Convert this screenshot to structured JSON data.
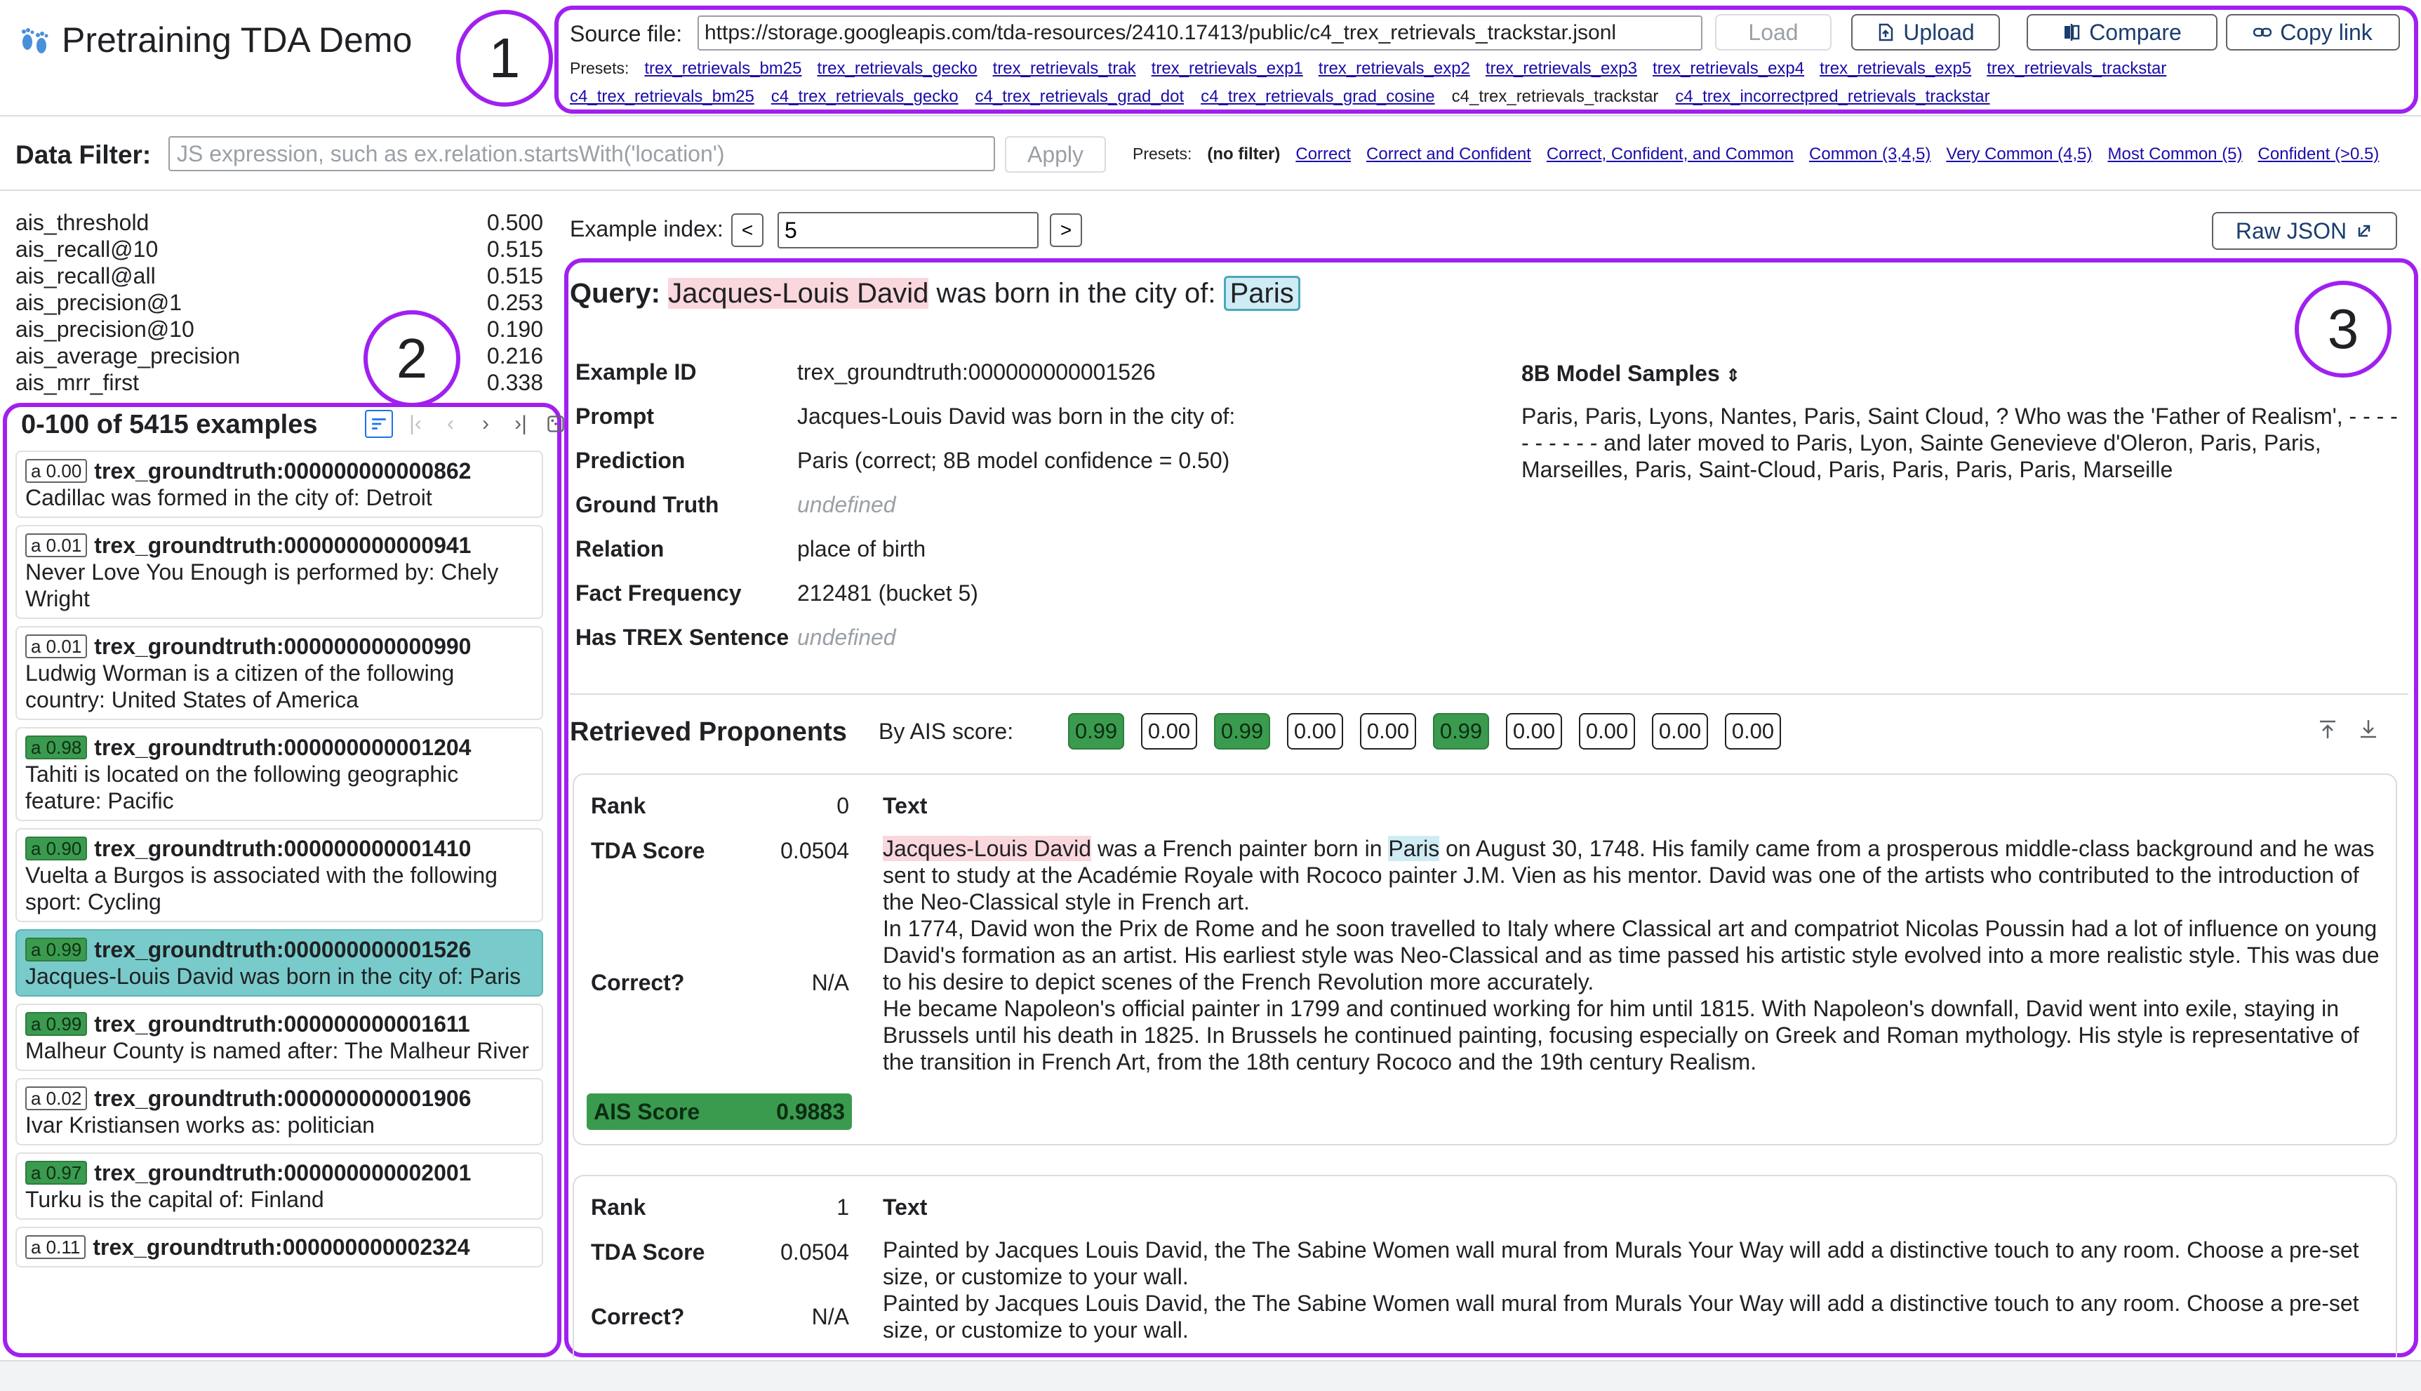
{
  "header": {
    "title": "Pretraining TDA Demo",
    "source_label": "Source file:",
    "source_value": "https://storage.googleapis.com/tda-resources/2410.17413/public/c4_trex_retrievals_trackstar.jsonl",
    "load": "Load",
    "upload": "Upload",
    "compare": "Compare",
    "copy_link": "Copy link",
    "presets_label": "Presets:",
    "presets_line1": [
      "trex_retrievals_bm25",
      "trex_retrievals_gecko",
      "trex_retrievals_trak",
      "trex_retrievals_exp1",
      "trex_retrievals_exp2",
      "trex_retrievals_exp3",
      "trex_retrievals_exp4",
      "trex_retrievals_exp5",
      "trex_retrievals_trackstar"
    ],
    "presets_line2": [
      "c4_trex_retrievals_bm25",
      "c4_trex_retrievals_gecko",
      "c4_trex_retrievals_grad_dot",
      "c4_trex_retrievals_grad_cosine",
      "c4_trex_retrievals_trackstar",
      "c4_trex_incorrectpred_retrievals_trackstar"
    ]
  },
  "annotations": {
    "one": "1",
    "two": "2",
    "three": "3"
  },
  "filter": {
    "label": "Data Filter:",
    "placeholder": "JS expression, such as ex.relation.startsWith('location')",
    "apply": "Apply",
    "presets_label": "Presets:",
    "no_filter": "(no filter)",
    "presets": [
      "Correct",
      "Correct and Confident",
      "Correct, Confident, and Common",
      "Common (3,4,5)",
      "Very Common (4,5)",
      "Most Common (5)",
      "Confident (>0.5)"
    ]
  },
  "metrics": [
    {
      "name": "ais_threshold",
      "value": "0.500"
    },
    {
      "name": "ais_recall@10",
      "value": "0.515"
    },
    {
      "name": "ais_recall@all",
      "value": "0.515"
    },
    {
      "name": "ais_precision@1",
      "value": "0.253"
    },
    {
      "name": "ais_precision@10",
      "value": "0.190"
    },
    {
      "name": "ais_average_precision",
      "value": "0.216"
    },
    {
      "name": "ais_mrr_first",
      "value": "0.338"
    }
  ],
  "list": {
    "header": "0-100 of 5415 examples",
    "items": [
      {
        "badge": "a 0.00",
        "hi": false,
        "id": "trex_groundtruth:000000000000862",
        "text": "Cadillac was formed in the city of: Detroit"
      },
      {
        "badge": "a 0.01",
        "hi": false,
        "id": "trex_groundtruth:000000000000941",
        "text": "Never Love You Enough is performed by: Chely Wright"
      },
      {
        "badge": "a 0.01",
        "hi": false,
        "id": "trex_groundtruth:000000000000990",
        "text": "Ludwig Worman is a citizen of the following country: United States of America"
      },
      {
        "badge": "a 0.98",
        "hi": true,
        "id": "trex_groundtruth:000000000001204",
        "text": "Tahiti is located on the following geographic feature: Pacific"
      },
      {
        "badge": "a 0.90",
        "hi": true,
        "id": "trex_groundtruth:000000000001410",
        "text": "Vuelta a Burgos is associated with the following sport: Cycling"
      },
      {
        "badge": "a 0.99",
        "hi": true,
        "id": "trex_groundtruth:000000000001526",
        "text": "Jacques-Louis David was born in the city of: Paris",
        "selected": true
      },
      {
        "badge": "a 0.99",
        "hi": true,
        "id": "trex_groundtruth:000000000001611",
        "text": "Malheur County is named after: The Malheur River"
      },
      {
        "badge": "a 0.02",
        "hi": false,
        "id": "trex_groundtruth:000000000001906",
        "text": "Ivar Kristiansen works as: politician"
      },
      {
        "badge": "a 0.97",
        "hi": true,
        "id": "trex_groundtruth:000000000002001",
        "text": "Turku is the capital of: Finland"
      },
      {
        "badge": "a 0.11",
        "hi": false,
        "id": "trex_groundtruth:000000000002324",
        "text": ""
      }
    ]
  },
  "example": {
    "index_label": "Example index:",
    "index_value": "5",
    "raw_json": "Raw JSON",
    "query_label": "Query:",
    "query_subject": "Jacques-Louis David",
    "query_middle": "was born in the city of:",
    "query_object": "Paris",
    "details": [
      {
        "label": "Example ID",
        "value": "trex_groundtruth:000000000001526",
        "undef": false
      },
      {
        "label": "Prompt",
        "value": "Jacques-Louis David was born in the city of:",
        "undef": false
      },
      {
        "label": "Prediction",
        "value": "Paris (correct;  8B model confidence = 0.50)",
        "undef": false
      },
      {
        "label": "Ground Truth",
        "value": "undefined",
        "undef": true
      },
      {
        "label": "Relation",
        "value": "place of birth",
        "undef": false
      },
      {
        "label": "Fact Frequency",
        "value": "212481 (bucket 5)",
        "undef": false
      },
      {
        "label": "Has TREX Sentence",
        "value": "undefined",
        "undef": true
      }
    ],
    "samples_label": "8B Model Samples",
    "samples_text": "Paris, Paris, Lyons, Nantes, Paris, Saint Cloud, ? Who was the 'Father of Realism', - - - - - - - - - - and later moved to Paris, Lyon, Sainte Genevieve d'Oleron, Paris, Paris, Marseilles, Paris, Saint-Cloud, Paris, Paris, Paris, Paris, Marseille"
  },
  "retrieved": {
    "title": "Retrieved Proponents",
    "by_label": "By AIS score:",
    "chips": [
      {
        "v": "0.99",
        "hi": true
      },
      {
        "v": "0.00",
        "hi": false
      },
      {
        "v": "0.99",
        "hi": true
      },
      {
        "v": "0.00",
        "hi": false
      },
      {
        "v": "0.00",
        "hi": false
      },
      {
        "v": "0.99",
        "hi": true
      },
      {
        "v": "0.00",
        "hi": false
      },
      {
        "v": "0.00",
        "hi": false
      },
      {
        "v": "0.00",
        "hi": false
      },
      {
        "v": "0.00",
        "hi": false
      }
    ],
    "labels": {
      "rank": "Rank",
      "tda": "TDA Score",
      "correct": "Correct?",
      "ais": "AIS Score",
      "text": "Text"
    },
    "cards": [
      {
        "rank": "0",
        "tda": "0.0504",
        "correct": "N/A",
        "ais": "0.9883",
        "p1_subject": "Jacques-Louis David",
        "p1_a": "was a French painter born in",
        "p1_object": "Paris",
        "p1_b": "on August 30, 1748. His family came from a prosperous middle-class background and he was sent to study at the Académie Royale with Rococo painter J.M. Vien as his mentor. David was one of the artists who contributed to the introduction of the Neo-Classical style in French art.",
        "p2": "In 1774, David won the Prix de Rome and he soon travelled to Italy where Classical art and compatriot Nicolas Poussin had a lot of influence on young David's formation as an artist. His earliest style was Neo-Classical and as time passed his artistic style evolved into a more realistic style. This was due to his desire to depict scenes of the French Revolution more accurately.",
        "p3": "He became Napoleon's official painter in 1799 and continued working for him until 1815. With Napoleon's downfall, David went into exile, staying in Brussels until his death in 1825. In Brussels he continued painting, focusing especially on Greek and Roman mythology. His style is representative of the transition in French Art, from the 18th century Rococo and the 19th century Realism."
      },
      {
        "rank": "1",
        "tda": "0.0504",
        "correct": "N/A",
        "p1": "Painted by Jacques Louis David, the The Sabine Women wall mural from Murals Your Way will add a distinctive touch to any room. Choose a pre-set size, or customize to your wall.",
        "p2": "Painted by Jacques Louis David, the The Sabine Women wall mural from Murals Your Way will add a distinctive touch to any room. Choose a pre-set size, or customize to your wall."
      }
    ]
  }
}
